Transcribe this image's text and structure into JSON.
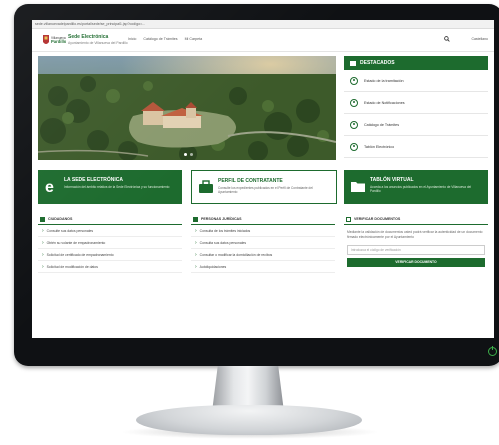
{
  "browser": {
    "url": "sede.villanuevadelpardillo.es/portal/sede/se_principal1.jsp?codigo=..."
  },
  "site": {
    "title": "Sede Electrónica",
    "subtitle": "Ayuntamiento de Villanueva del Pardillo",
    "nav": [
      "Inicio",
      "Catálogo de Trámites",
      "Mi Carpeta"
    ],
    "language": "Castellano"
  },
  "destacados": {
    "title": "DESTACADOS",
    "items": [
      {
        "label": "Estado de la tramitación",
        "icon": "clock-icon"
      },
      {
        "label": "Estado de Notificaciones",
        "icon": "bell-icon"
      },
      {
        "label": "Catálogo de Trámites",
        "icon": "list-icon"
      },
      {
        "label": "Tablón Electrónico",
        "icon": "board-icon"
      }
    ]
  },
  "tiles": [
    {
      "title": "LA SEDE ELECTRÓNICA",
      "text": "Información del ámbito relativa de la Sede Electrónica y su funcionamiento",
      "icon": "e-icon"
    },
    {
      "title": "PERFIL DE CONTRATANTE",
      "text": "Consulte los expedientes publicados en el Perfil de Contratante del Ayuntamiento",
      "icon": "briefcase-icon"
    },
    {
      "title": "TABLÓN VIRTUAL",
      "text": "Acceda a los anuncios publicados en el Ayuntamiento de Villanueva del Pardillo",
      "icon": "folder-icon"
    }
  ],
  "columns": {
    "ciudadanos": {
      "title": "CIUDADANOS",
      "items": [
        "Consulte sus datos personales",
        "Obtén su volante de empadronamiento",
        "Solicitud de certificado de empadronamiento",
        "Solicitud de modificación de datos"
      ]
    },
    "personas": {
      "title": "PERSONAS JURÍDICAS",
      "items": [
        "Consulta de los trámites iniciados",
        "Consulta sus datos personales",
        "Consultar o modificar la domiciliación de recibos",
        "Autoliquidaciones"
      ]
    },
    "verificar": {
      "title": "VERIFICAR DOCUMENTOS",
      "text": "Mediante la validación de documentos usted podrá verificar la autenticidad de un documento firmado electrónicamente por el Ayuntamiento",
      "placeholder": "Introduzca el código de verificación",
      "button": "VERIFICAR DOCUMENTO"
    }
  },
  "colors": {
    "primary": "#1d6b2e",
    "frame": "#0f1114"
  }
}
